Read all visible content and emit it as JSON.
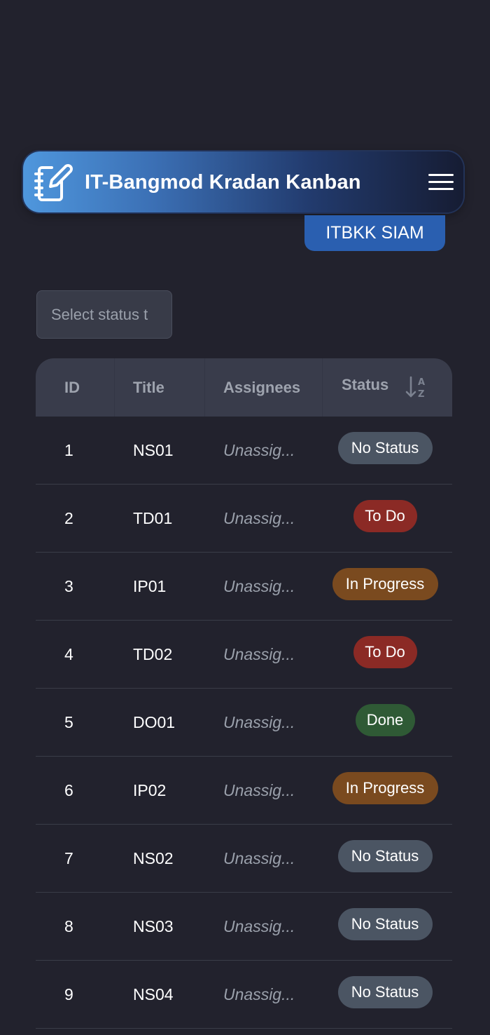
{
  "navbar": {
    "title": "IT-Bangmod Kradan Kanban",
    "logo_icon": "notebook-pen-icon",
    "menu_icon": "hamburger-menu-icon"
  },
  "board": {
    "name": "ITBKK SIAM"
  },
  "filter": {
    "placeholder": "Select status t"
  },
  "table": {
    "columns": [
      "ID",
      "Title",
      "Assignees",
      "Status"
    ],
    "sort_icon": "sort-alpha-ascending-icon",
    "rows": [
      {
        "id": "1",
        "title": "NS01",
        "assignees": "Unassig...",
        "status": "No Status"
      },
      {
        "id": "2",
        "title": "TD01",
        "assignees": "Unassig...",
        "status": "To Do"
      },
      {
        "id": "3",
        "title": "IP01",
        "assignees": "Unassig...",
        "status": "In Progress"
      },
      {
        "id": "4",
        "title": "TD02",
        "assignees": "Unassig...",
        "status": "To Do"
      },
      {
        "id": "5",
        "title": "DO01",
        "assignees": "Unassig...",
        "status": "Done"
      },
      {
        "id": "6",
        "title": "IP02",
        "assignees": "Unassig...",
        "status": "In Progress"
      },
      {
        "id": "7",
        "title": "NS02",
        "assignees": "Unassig...",
        "status": "No Status"
      },
      {
        "id": "8",
        "title": "NS03",
        "assignees": "Unassig...",
        "status": "No Status"
      },
      {
        "id": "9",
        "title": "NS04",
        "assignees": "Unassig...",
        "status": "No Status"
      }
    ]
  },
  "status_colors": {
    "No Status": "#4b5563",
    "To Do": "#8b2a25",
    "In Progress": "#7a4a1f",
    "Done": "#2f5a35"
  }
}
